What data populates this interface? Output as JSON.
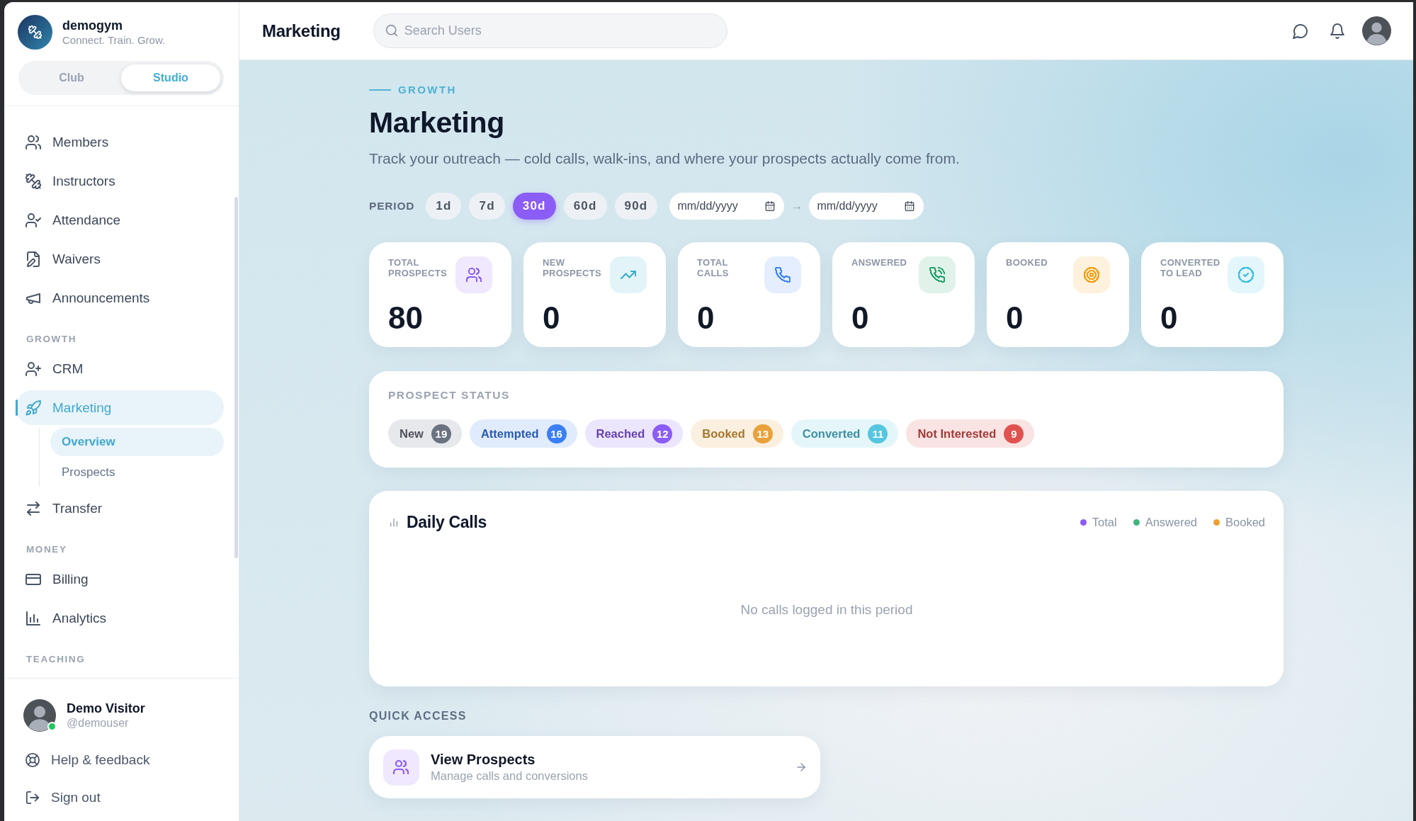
{
  "sidebar": {
    "brand": {
      "name": "demogym",
      "tagline": "Connect. Train. Grow."
    },
    "mode_toggle": [
      {
        "label": "Club",
        "selected": false
      },
      {
        "label": "Studio",
        "selected": true
      }
    ],
    "sections": [
      {
        "items": [
          {
            "label": "Members",
            "selected": false
          },
          {
            "label": "Instructors",
            "selected": false
          },
          {
            "label": "Attendance",
            "selected": false
          },
          {
            "label": "Waivers",
            "selected": false
          },
          {
            "label": "Announcements",
            "selected": false
          }
        ]
      },
      {
        "heading": "GROWTH",
        "items": [
          {
            "label": "CRM",
            "selected": false
          },
          {
            "label": "Marketing",
            "selected": true,
            "children": [
              {
                "label": "Overview",
                "selected": true
              },
              {
                "label": "Prospects",
                "selected": false
              }
            ]
          },
          {
            "label": "Transfer",
            "selected": false
          }
        ]
      },
      {
        "heading": "MONEY",
        "items": [
          {
            "label": "Billing",
            "selected": false
          },
          {
            "label": "Analytics",
            "selected": false
          }
        ]
      },
      {
        "heading": "TEACHING"
      }
    ],
    "user": {
      "name": "Demo Visitor",
      "handle": "@demouser",
      "online": true
    },
    "footer_links": [
      "Help & feedback",
      "Sign out"
    ]
  },
  "top_bar": {
    "title": "Marketing",
    "search": {
      "placeholder": "Search Users"
    }
  },
  "page": {
    "eyebrow": "GROWTH",
    "title": "Marketing",
    "subtitle": "Track your outreach — cold calls, walk-ins, and where your prospects actually come from."
  },
  "period": {
    "label": "PERIOD",
    "options": [
      {
        "label": "1d",
        "selected": false
      },
      {
        "label": "7d",
        "selected": false
      },
      {
        "label": "30d",
        "selected": true
      },
      {
        "label": "60d",
        "selected": false
      },
      {
        "label": "90d",
        "selected": false
      }
    ],
    "date_from": {
      "placeholder": "mm/dd/yyyy"
    },
    "separator": "→",
    "date_to": {
      "placeholder": "mm/dd/yyyy"
    }
  },
  "stats": [
    {
      "label": "TOTAL PROSPECTS",
      "value": "80",
      "color": "#8b5cf6"
    },
    {
      "label": "NEW PROSPECTS",
      "value": "0",
      "color": "#3aaed0"
    },
    {
      "label": "TOTAL CALLS",
      "value": "0",
      "color": "#3b82f6"
    },
    {
      "label": "ANSWERED",
      "value": "0",
      "color": "#22a06b"
    },
    {
      "label": "BOOKED",
      "value": "0",
      "color": "#f59e0b"
    },
    {
      "label": "CONVERTED TO LEAD",
      "value": "0",
      "color": "#38bfe0"
    }
  ],
  "prospect_status": {
    "title": "PROSPECT STATUS",
    "statuses": [
      {
        "label": "New",
        "count": "19",
        "color": "#6b7280"
      },
      {
        "label": "Attempted",
        "count": "16",
        "color": "#3b7ff5"
      },
      {
        "label": "Reached",
        "count": "12",
        "color": "#8b5cf6"
      },
      {
        "label": "Booked",
        "count": "13",
        "color": "#e9a23b"
      },
      {
        "label": "Converted",
        "count": "11",
        "color": "#56c6e0"
      },
      {
        "label": "Not Interested",
        "count": "9",
        "color": "#e0524f"
      }
    ]
  },
  "daily_calls": {
    "title": "Daily Calls",
    "legend": [
      {
        "label": "Total",
        "color": "#8b5cf6"
      },
      {
        "label": "Answered",
        "color": "#3fb67c"
      },
      {
        "label": "Booked",
        "color": "#f0a030"
      }
    ],
    "empty_message": "No calls logged in this period"
  },
  "quick_access": {
    "title": "QUICK ACCESS",
    "links": [
      {
        "title": "View Prospects",
        "subtitle": "Manage calls and conversions"
      }
    ]
  }
}
